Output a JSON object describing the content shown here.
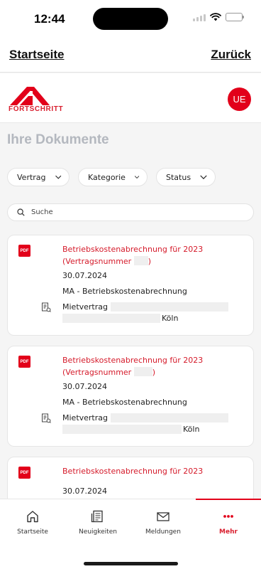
{
  "status_bar": {
    "time": "12:44"
  },
  "top_nav": {
    "home_link": "Startseite",
    "back_link": "Zurück"
  },
  "brand": {
    "logo_text": "FORTSCHRITT",
    "avatar_initials": "UE",
    "accent": "#e2001a"
  },
  "section_title": "Ihre Dokumente",
  "filters": [
    {
      "label": "Vertrag"
    },
    {
      "label": "Kategorie"
    },
    {
      "label": "Status"
    }
  ],
  "search": {
    "placeholder": "Suche",
    "icon": "search-icon"
  },
  "documents": [
    {
      "file_badge": "PDF",
      "title_line1": "Betriebskostenabrechnung für 2023",
      "title_line2_prefix": "(Vertragsnummer",
      "title_line2_suffix": ")",
      "date": "30.07.2024",
      "type": "MA - Betriebskostenabrechnung",
      "contract_label": "Mietvertrag",
      "city": "Köln"
    },
    {
      "file_badge": "PDF",
      "title_line1": "Betriebskostenabrechnung für 2023",
      "title_line2_prefix": "(Vertragsnummer",
      "title_line2_suffix": ")",
      "date": "30.07.2024",
      "type": "MA - Betriebskostenabrechnung",
      "contract_label": "Mietvertrag",
      "city": "Köln"
    },
    {
      "file_badge": "PDF",
      "title_line1": "Betriebskostenabrechnung für 2023",
      "date": "30.07.2024"
    }
  ],
  "bottom_nav": {
    "tabs": [
      {
        "label": "Startseite",
        "icon": "house-icon"
      },
      {
        "label": "Neuigkeiten",
        "icon": "newspaper-icon"
      },
      {
        "label": "Meldungen",
        "icon": "envelope-icon"
      },
      {
        "label": "Mehr",
        "icon": "more-dots-icon",
        "active": true
      }
    ]
  }
}
